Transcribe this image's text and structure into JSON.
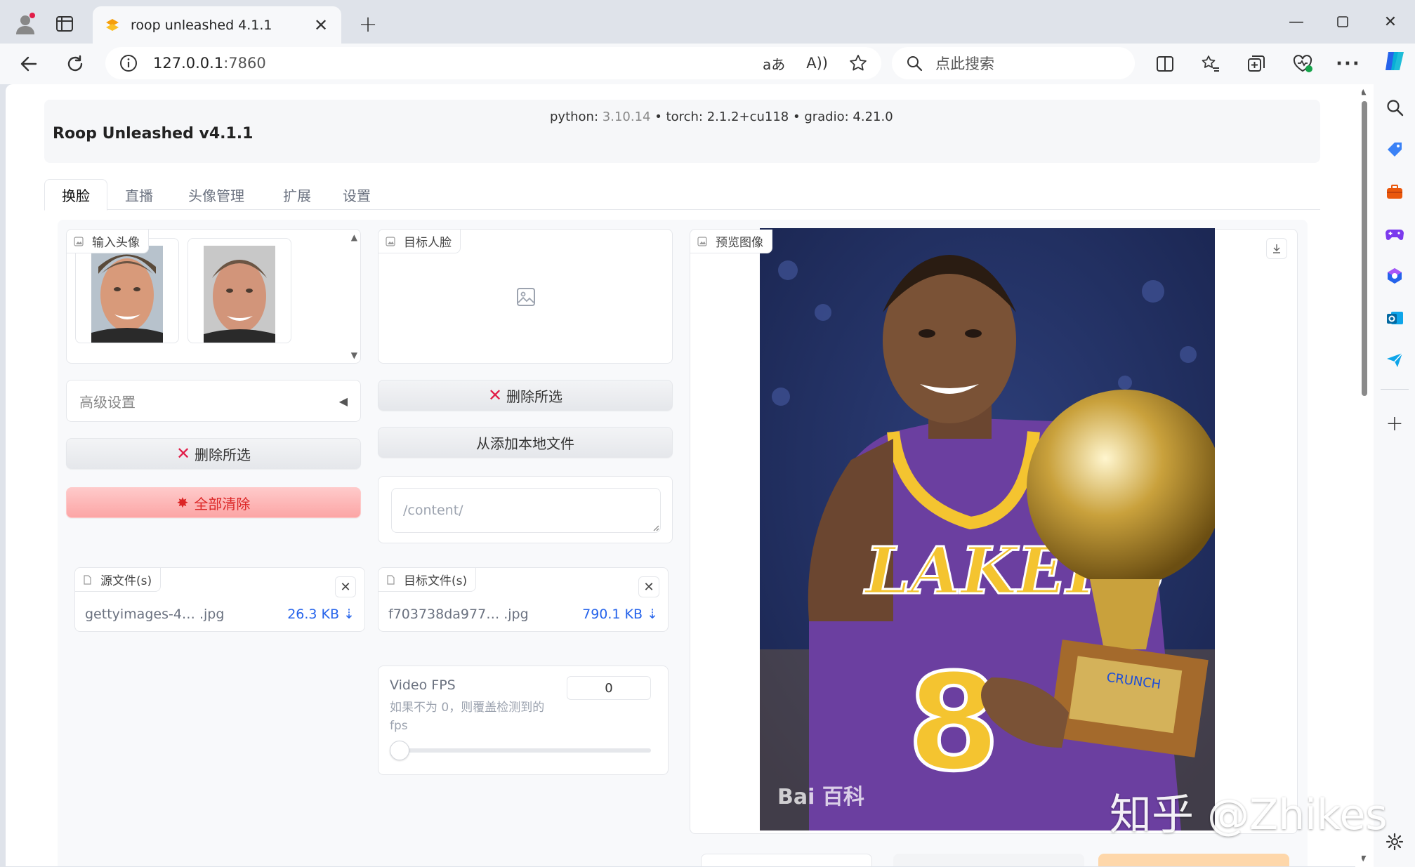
{
  "browser": {
    "tab_title": "roop unleashed 4.1.1",
    "url_host": "127.0.0.1",
    "url_port": ":7860",
    "search_placeholder": "点此搜索"
  },
  "app": {
    "title": "Roop Unleashed v4.1.1",
    "versions": {
      "python_label": "python: ",
      "python_value": "3.10.14",
      "rest": " • torch: 2.1.2+cu118 • gradio: 4.21.0"
    },
    "tabs": [
      "换脸",
      "直播",
      "头像管理",
      "扩展",
      "设置"
    ],
    "active_tab": "换脸"
  },
  "left": {
    "input_faces_label": "输入头像",
    "advanced_settings_label": "高级设置",
    "delete_selected_label": "删除所选",
    "clear_all_label": "全部清除",
    "source_files_label": "源文件(s)",
    "source_file": {
      "name": "gettyimages-4… .jpg",
      "size": "26.3 KB ⇣"
    }
  },
  "middle": {
    "target_face_label": "目标人脸",
    "delete_selected_label": "删除所选",
    "add_local_files_label": "从添加本地文件",
    "path_placeholder": "/content/",
    "target_files_label": "目标文件(s)",
    "target_file": {
      "name": "f703738da977… .jpg",
      "size": "790.1 KB ⇣"
    },
    "video_fps": {
      "label": "Video FPS",
      "info": "如果不为 0，则覆盖检测到的 fps",
      "value": "0",
      "slider_value": 0
    }
  },
  "right": {
    "preview_label": "预览图像",
    "watermark_baidu": "Bai 百科",
    "watermark_zhihu": "知乎 @Zhikes"
  },
  "colors": {
    "accent_blue": "#2563eb",
    "danger_red": "#dc2626",
    "danger_bg": "#fca5a5"
  }
}
